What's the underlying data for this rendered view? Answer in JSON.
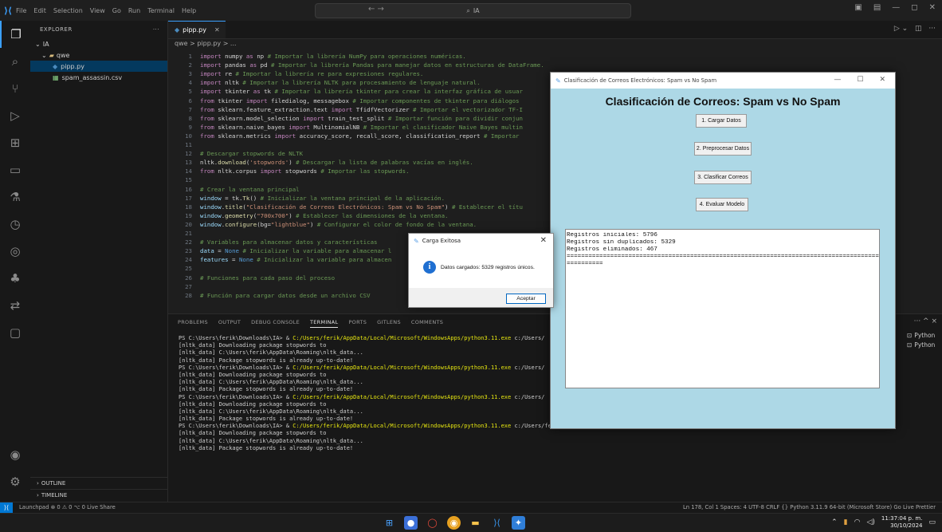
{
  "titlebar": {
    "menu": [
      "File",
      "Edit",
      "Selection",
      "View",
      "Go",
      "Run",
      "Terminal",
      "Help"
    ],
    "search": "IA",
    "nav_arrows": "← →"
  },
  "sidebar": {
    "title": "EXPLORER",
    "more": "···",
    "root": "IA",
    "folder": "qwe",
    "files": [
      "pipp.py",
      "spam_assassin.csv"
    ],
    "outline": "OUTLINE",
    "timeline": "TIMELINE"
  },
  "editor": {
    "tab": "pipp.py",
    "breadcrumb": "qwe > pipp.py > ..."
  },
  "code_lines": [
    {
      "n": "1",
      "parts": [
        [
          "kw",
          "import"
        ],
        [
          "tx",
          " numpy "
        ],
        [
          "kw",
          "as"
        ],
        [
          "tx",
          " np  "
        ],
        [
          "cmt",
          "# Importar la librería NumPy para operaciones numéricas."
        ]
      ]
    },
    {
      "n": "2",
      "parts": [
        [
          "kw",
          "import"
        ],
        [
          "tx",
          " pandas "
        ],
        [
          "kw",
          "as"
        ],
        [
          "tx",
          " pd  "
        ],
        [
          "cmt",
          "# Importar la librería Pandas para manejar datos en estructuras de DataFrame."
        ]
      ]
    },
    {
      "n": "3",
      "parts": [
        [
          "kw",
          "import"
        ],
        [
          "tx",
          " re  "
        ],
        [
          "cmt",
          "# Importar la librería re para expresiones regulares."
        ]
      ]
    },
    {
      "n": "4",
      "parts": [
        [
          "kw",
          "import"
        ],
        [
          "tx",
          " nltk  "
        ],
        [
          "cmt",
          "# Importar la librería NLTK para procesamiento de lenguaje natural."
        ]
      ]
    },
    {
      "n": "5",
      "parts": [
        [
          "kw",
          "import"
        ],
        [
          "tx",
          " tkinter "
        ],
        [
          "kw",
          "as"
        ],
        [
          "tx",
          " tk  "
        ],
        [
          "cmt",
          "# Importar la librería tkinter para crear la interfaz gráfica de usuar"
        ]
      ]
    },
    {
      "n": "6",
      "parts": [
        [
          "kw",
          "from"
        ],
        [
          "tx",
          " tkinter "
        ],
        [
          "kw",
          "import"
        ],
        [
          "tx",
          " filedialog, messagebox  "
        ],
        [
          "cmt",
          "# Importar componentes de tkinter para diálogos"
        ]
      ]
    },
    {
      "n": "7",
      "parts": [
        [
          "kw",
          "from"
        ],
        [
          "tx",
          " sklearn.feature_extraction.text "
        ],
        [
          "kw",
          "import"
        ],
        [
          "tx",
          " TfidfVectorizer  "
        ],
        [
          "cmt",
          "# Importar el vectorizador TF-I"
        ]
      ]
    },
    {
      "n": "8",
      "parts": [
        [
          "kw",
          "from"
        ],
        [
          "tx",
          " sklearn.model_selection "
        ],
        [
          "kw",
          "import"
        ],
        [
          "tx",
          " train_test_split  "
        ],
        [
          "cmt",
          "# Importar función para dividir conjun"
        ]
      ]
    },
    {
      "n": "9",
      "parts": [
        [
          "kw",
          "from"
        ],
        [
          "tx",
          " sklearn.naive_bayes "
        ],
        [
          "kw",
          "import"
        ],
        [
          "tx",
          " MultinomialNB  "
        ],
        [
          "cmt",
          "# Importar el clasificador Naive Bayes multin"
        ]
      ]
    },
    {
      "n": "10",
      "parts": [
        [
          "kw",
          "from"
        ],
        [
          "tx",
          " sklearn.metrics "
        ],
        [
          "kw",
          "import"
        ],
        [
          "tx",
          " accuracy_score, recall_score, classification_report  "
        ],
        [
          "cmt",
          "# Importar"
        ]
      ]
    },
    {
      "n": "11",
      "parts": []
    },
    {
      "n": "12",
      "parts": [
        [
          "cmt",
          "# Descargar stopwords de NLTK"
        ]
      ]
    },
    {
      "n": "13",
      "parts": [
        [
          "tx",
          "nltk."
        ],
        [
          "fn",
          "download"
        ],
        [
          "tx",
          "("
        ],
        [
          "str",
          "'stopwords'"
        ],
        [
          "tx",
          ")  "
        ],
        [
          "cmt",
          "# Descargar la lista de palabras vacías en inglés."
        ]
      ]
    },
    {
      "n": "14",
      "parts": [
        [
          "kw",
          "from"
        ],
        [
          "tx",
          " nltk.corpus "
        ],
        [
          "kw",
          "import"
        ],
        [
          "tx",
          " stopwords  "
        ],
        [
          "cmt",
          "# Importar las stopwords."
        ]
      ]
    },
    {
      "n": "15",
      "parts": []
    },
    {
      "n": "16",
      "parts": [
        [
          "cmt",
          "# Crear la ventana principal"
        ]
      ]
    },
    {
      "n": "17",
      "parts": [
        [
          "nm",
          "window"
        ],
        [
          "tx",
          " = tk."
        ],
        [
          "fn",
          "Tk"
        ],
        [
          "tx",
          "()  "
        ],
        [
          "cmt",
          "# Inicializar la ventana principal de la aplicación."
        ]
      ]
    },
    {
      "n": "18",
      "parts": [
        [
          "nm",
          "window"
        ],
        [
          "tx",
          "."
        ],
        [
          "fn",
          "title"
        ],
        [
          "tx",
          "("
        ],
        [
          "str",
          "\"Clasificación de Correos Electrónicos: Spam vs No Spam\""
        ],
        [
          "tx",
          ")  "
        ],
        [
          "cmt",
          "# Establecer el títu"
        ]
      ]
    },
    {
      "n": "19",
      "parts": [
        [
          "nm",
          "window"
        ],
        [
          "tx",
          "."
        ],
        [
          "fn",
          "geometry"
        ],
        [
          "tx",
          "("
        ],
        [
          "str",
          "\"700x700\""
        ],
        [
          "tx",
          ")  "
        ],
        [
          "cmt",
          "# Establecer las dimensiones de la ventana."
        ]
      ]
    },
    {
      "n": "20",
      "parts": [
        [
          "nm",
          "window"
        ],
        [
          "tx",
          "."
        ],
        [
          "fn",
          "configure"
        ],
        [
          "tx",
          "(bg="
        ],
        [
          "str",
          "\"lightblue\""
        ],
        [
          "tx",
          ")  "
        ],
        [
          "cmt",
          "# Configurar el color de fondo de la ventana."
        ]
      ]
    },
    {
      "n": "21",
      "parts": []
    },
    {
      "n": "22",
      "parts": [
        [
          "cmt",
          "# Variables para almacenar datos y características"
        ]
      ]
    },
    {
      "n": "23",
      "parts": [
        [
          "nm",
          "data"
        ],
        [
          "tx",
          " = "
        ],
        [
          "kc",
          "None"
        ],
        [
          "tx",
          "  "
        ],
        [
          "cmt",
          "# Inicializar la variable para almacenar l"
        ]
      ]
    },
    {
      "n": "24",
      "parts": [
        [
          "nm",
          "features"
        ],
        [
          "tx",
          " = "
        ],
        [
          "kc",
          "None"
        ],
        [
          "tx",
          "  "
        ],
        [
          "cmt",
          "# Inicializar la variable para almacen"
        ]
      ]
    },
    {
      "n": "25",
      "parts": []
    },
    {
      "n": "26",
      "parts": [
        [
          "cmt",
          "# Funciones para cada paso del proceso"
        ]
      ]
    },
    {
      "n": "27",
      "parts": []
    },
    {
      "n": "28",
      "parts": [
        [
          "cmt",
          "# Función para cargar datos desde un archivo CSV"
        ]
      ]
    }
  ],
  "panel": {
    "tabs": [
      "PROBLEMS",
      "OUTPUT",
      "DEBUG CONSOLE",
      "TERMINAL",
      "PORTS",
      "GITLENS",
      "COMMENTS"
    ],
    "active_tab": "TERMINAL",
    "controls": "··· ^ ×",
    "terminals": [
      "Python",
      "Python"
    ]
  },
  "terminal_lines": [
    {
      "a": "PS C:\\Users\\ferik\\Downloads\\IA> & ",
      "b": "C:/Users/ferik/AppData/Local/Microsoft/WindowsApps/python3.11.exe",
      "c": " c:/Users/"
    },
    {
      "a": "[nltk_data] Downloading package stopwords to",
      "b": "",
      "c": ""
    },
    {
      "a": "[nltk_data]     C:\\Users\\ferik\\AppData\\Roaming\\nltk_data...",
      "b": "",
      "c": ""
    },
    {
      "a": "[nltk_data]   Package stopwords is already up-to-date!",
      "b": "",
      "c": ""
    },
    {
      "a": "PS C:\\Users\\ferik\\Downloads\\IA> & ",
      "b": "C:/Users/ferik/AppData/Local/Microsoft/WindowsApps/python3.11.exe",
      "c": " c:/Users/"
    },
    {
      "a": "[nltk_data] Downloading package stopwords to",
      "b": "",
      "c": ""
    },
    {
      "a": "[nltk_data]     C:\\Users\\ferik\\AppData\\Roaming\\nltk_data...",
      "b": "",
      "c": ""
    },
    {
      "a": "[nltk_data]   Package stopwords is already up-to-date!",
      "b": "",
      "c": ""
    },
    {
      "a": "PS C:\\Users\\ferik\\Downloads\\IA> & ",
      "b": "C:/Users/ferik/AppData/Local/Microsoft/WindowsApps/python3.11.exe",
      "c": " c:/Users/"
    },
    {
      "a": "[nltk_data] Downloading package stopwords to",
      "b": "",
      "c": ""
    },
    {
      "a": "[nltk_data]     C:\\Users\\ferik\\AppData\\Roaming\\nltk_data...",
      "b": "",
      "c": ""
    },
    {
      "a": "[nltk_data]   Package stopwords is already up-to-date!",
      "b": "",
      "c": ""
    },
    {
      "a": "PS C:\\Users\\ferik\\Downloads\\IA> & ",
      "b": "C:/Users/ferik/AppData/Local/Microsoft/WindowsApps/python3.11.exe",
      "c": " c:/Users/ferik/Downloads/IA/qwe/pipp.py"
    },
    {
      "a": "[nltk_data] Downloading package stopwords to",
      "b": "",
      "c": ""
    },
    {
      "a": "[nltk_data]     C:\\Users\\ferik\\AppData\\Roaming\\nltk_data...",
      "b": "",
      "c": ""
    },
    {
      "a": "[nltk_data]   Package stopwords is already up-to-date!",
      "b": "",
      "c": ""
    }
  ],
  "status": {
    "left": "Launchpad   ⊗ 0 ⚠ 0   ⌥ 0   Live Share",
    "right": "Ln 178, Col 1   Spaces: 4   UTF-8   CRLF   {} Python   3.11.9 64-bit (Microsoft Store)   Go Live   Prettier"
  },
  "taskbar": {
    "time": "11:37:04 p. m.",
    "date": "30/10/2024"
  },
  "app_window": {
    "title": "Clasificación de Correos Electrónicos: Spam vs No Spam",
    "heading": "Clasificación de Correos: Spam vs No Spam",
    "buttons": [
      "1. Cargar Datos",
      "2. Preprocesar Datos",
      "3. Clasificar Correos",
      "4. Evaluar Modelo"
    ],
    "output": [
      "Registros iniciales: 5796",
      "Registros sin duplicados: 5329",
      "Registros eliminados: 467",
      "=========================================================================================",
      "=========="
    ]
  },
  "dialog": {
    "title": "Carga Exitosa",
    "message": "Datos cargados: 5329 registros únicos.",
    "ok": "Aceptar"
  },
  "colors": {
    "accent": "#0078d4",
    "app_bg": "#add8e6"
  }
}
